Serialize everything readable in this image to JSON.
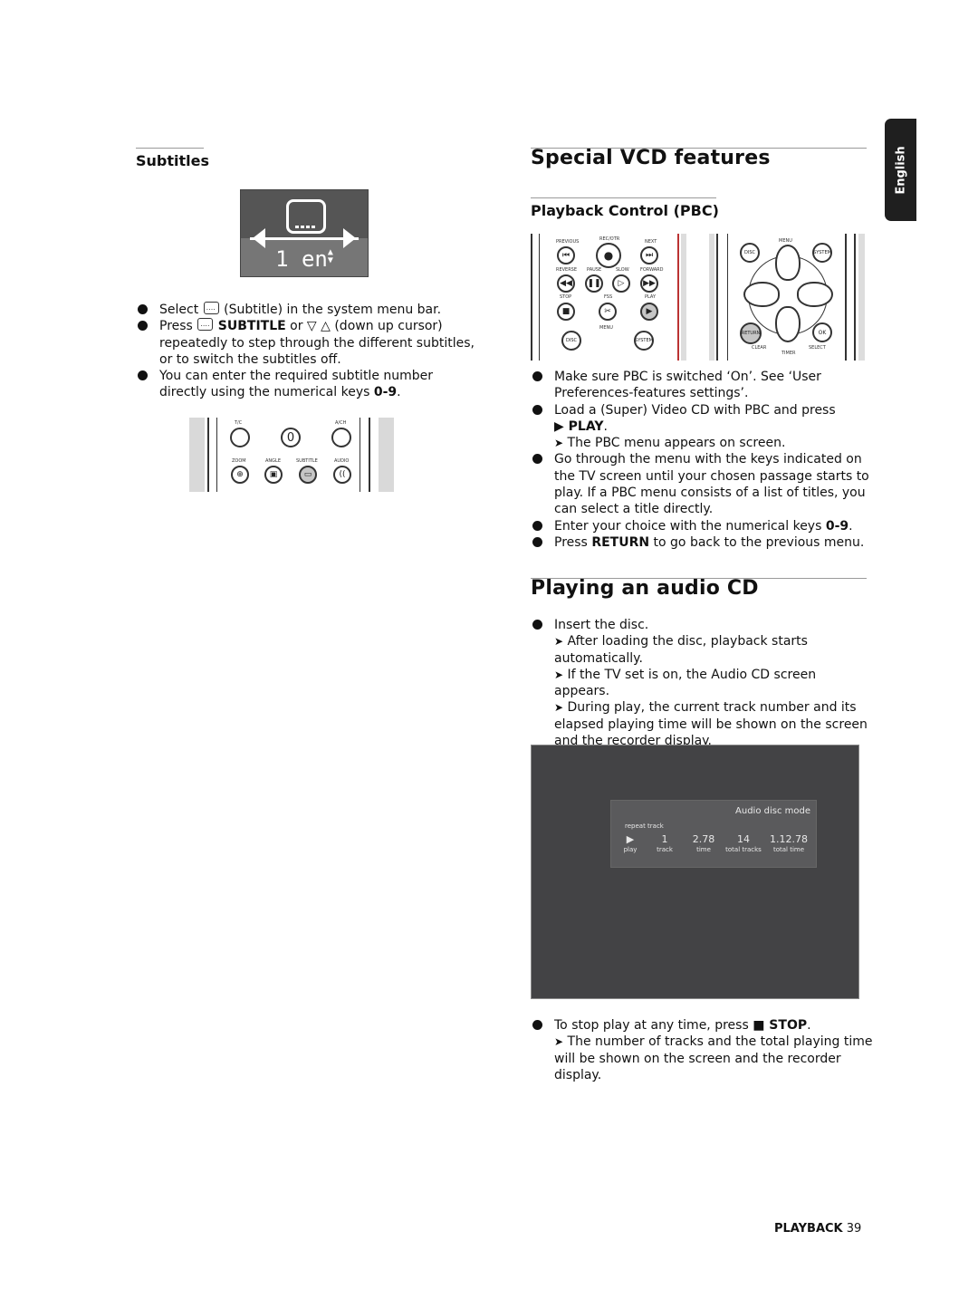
{
  "language_tab": "English",
  "left_column": {
    "heading": "Subtitles",
    "osd": {
      "icon": "subtitle-icon",
      "value": "1 en",
      "updown_icon": "up-down-arrows-icon"
    },
    "bullets": [
      {
        "pre": "Select",
        "icon": "subtitle-icon",
        "post": "(Subtitle) in the system menu bar."
      },
      {
        "pre": "Press",
        "icon": "subtitle-icon",
        "bold": "SUBTITLE",
        "mid": "or ▽ △ (down up cursor)",
        "post": "repeatedly to step through the different subtitles, or to switch the subtitles off."
      },
      {
        "pre": "You can enter the required subtitle number directly using the numerical keys",
        "bold": "0-9",
        "post": "."
      }
    ],
    "remote": {
      "top_labels": [
        "T/C",
        "A/CH"
      ],
      "zero_key": "0",
      "bottom_labels": [
        "ZOOM",
        "ANGLE",
        "SUBTITLE",
        "AUDIO"
      ]
    }
  },
  "right_column": {
    "heading": "Special VCD features",
    "subheading": "Playback Control (PBC)",
    "remote_left": {
      "labels": [
        "PREVIOUS",
        "REC/OTR",
        "NEXT",
        "REVERSE",
        "PAUSE",
        "SLOW",
        "FORWARD",
        "STOP",
        "FSS",
        "PLAY",
        "MENU",
        "DISC",
        "SYSTEM"
      ]
    },
    "remote_right": {
      "labels": [
        "MENU",
        "DISC",
        "SYSTEM",
        "RETURN",
        "OK",
        "CLEAR",
        "TIMER",
        "SELECT"
      ]
    },
    "pbc_bullets": [
      {
        "text": "Make sure PBC is switched ‘On’. See ‘User Preferences-features settings’."
      },
      {
        "text": "Load a (Super) Video CD with PBC and press",
        "bold": "▶ PLAY",
        "post": ".",
        "note": "The PBC menu appears on screen."
      },
      {
        "text": "Go through the menu with the keys indicated on the TV screen until your chosen passage starts to play. If a PBC menu consists of a list of titles, you can select a title directly."
      },
      {
        "text": "Enter your choice with the numerical keys",
        "bold": "0-9",
        "post": "."
      },
      {
        "text": "Press",
        "bold": "RETURN",
        "post": "to go back to the previous menu."
      }
    ],
    "audio_heading": "Playing an audio CD",
    "audio_bullet": {
      "text": "Insert the disc.",
      "notes": [
        "After loading the disc, playback starts automatically.",
        "If the TV set is on, the Audio CD screen appears.",
        "During play, the current track number and its elapsed playing time will be shown on the screen and the recorder display."
      ]
    },
    "cd_screen": {
      "mode": "Audio disc mode",
      "repeat": "repeat track",
      "columns": [
        {
          "value": "▶",
          "label": "play"
        },
        {
          "value": "1",
          "label": "track"
        },
        {
          "value": "2.78",
          "label": "time"
        },
        {
          "value": "14",
          "label": "total tracks"
        },
        {
          "value": "1.12.78",
          "label": "total time"
        }
      ]
    },
    "stop_bullet": {
      "text": "To stop play at any time, press",
      "bold": "■ STOP",
      "post": ".",
      "note": "The number of tracks and the total playing time will be shown on the screen and the recorder display."
    }
  },
  "footer": {
    "section": "PLAYBACK",
    "page": "39"
  },
  "arrow_glyph": "➤"
}
